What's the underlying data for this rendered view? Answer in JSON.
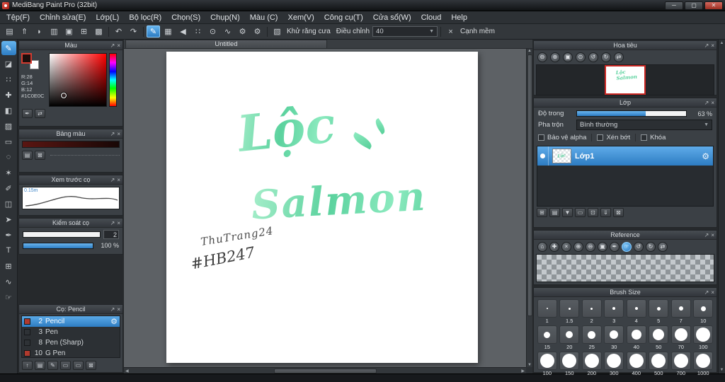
{
  "window": {
    "title": "MediBang Paint Pro (32bit)",
    "minimize": "─",
    "maximize": "▢",
    "close": "✕"
  },
  "menu": {
    "items": [
      "Tệp(F)",
      "Chỉnh sửa(E)",
      "Lớp(L)",
      "Bộ lọc(R)",
      "Chọn(S)",
      "Chụp(N)",
      "Màu (C)",
      "Xem(V)",
      "Công cụ(T)",
      "Cửa sổ(W)",
      "Cloud",
      "Help"
    ]
  },
  "toolbar": {
    "file_icons": [
      {
        "name": "new-canvas-icon",
        "glyph": "▤"
      },
      {
        "name": "save-icon",
        "glyph": "⇑"
      },
      {
        "name": "comment-icon",
        "glyph": "◗"
      },
      {
        "name": "copy-icon",
        "glyph": "▥"
      },
      {
        "name": "paste-icon",
        "glyph": "▣"
      },
      {
        "name": "grid-icon",
        "glyph": "⊞"
      },
      {
        "name": "material-panel-icon",
        "glyph": "▩"
      }
    ],
    "history_icons": [
      {
        "name": "undo-icon",
        "glyph": "↶"
      },
      {
        "name": "redo-icon",
        "glyph": "↷"
      }
    ],
    "brush_icons": [
      {
        "name": "current-tool-pen-icon",
        "glyph": "✎",
        "selected": true
      },
      {
        "name": "brush-type-icon",
        "glyph": "▦"
      },
      {
        "name": "brush-prev-icon",
        "glyph": "◀"
      },
      {
        "name": "brush-scatter-icon",
        "glyph": "∷"
      },
      {
        "name": "brush-pressure-icon",
        "glyph": "⊙"
      },
      {
        "name": "brush-curve-icon",
        "glyph": "∿"
      },
      {
        "name": "brush-settings-icon",
        "glyph": "⚙"
      },
      {
        "name": "brush-option-icon",
        "glyph": "⚙"
      }
    ],
    "antialias_icon": "▧",
    "antialias_label": "Khử răng cưa",
    "adjust_label": "Điều chỉnh",
    "adjust_value": "40",
    "soft_edge_icon": "×",
    "soft_edge_label": "Cạnh mềm"
  },
  "tools": {
    "items": [
      {
        "name": "brush-tool",
        "glyph": "✎",
        "selected": true
      },
      {
        "name": "eraser-tool",
        "glyph": "◪"
      },
      {
        "name": "dot-pen-tool",
        "glyph": "∷"
      },
      {
        "name": "move-tool",
        "glyph": "✚"
      },
      {
        "name": "bucket-tool",
        "glyph": "◧"
      },
      {
        "name": "gradient-tool",
        "glyph": "▨"
      },
      {
        "name": "select-tool",
        "glyph": "▭"
      },
      {
        "name": "lasso-tool",
        "glyph": "◌"
      },
      {
        "name": "magic-wand-tool",
        "glyph": "✶"
      },
      {
        "name": "select-pen-tool",
        "glyph": "✐"
      },
      {
        "name": "select-eraser-tool",
        "glyph": "◫"
      },
      {
        "name": "operation-tool",
        "glyph": "➤"
      },
      {
        "name": "eyedropper-tool",
        "glyph": "✒"
      },
      {
        "name": "text-tool",
        "glyph": "T"
      },
      {
        "name": "frame-tool",
        "glyph": "⊞"
      },
      {
        "name": "curve-tool",
        "glyph": "∿"
      },
      {
        "name": "hand-tool",
        "glyph": "☞"
      }
    ]
  },
  "color_panel": {
    "title": "Màu",
    "r": "R:28",
    "g": "G:14",
    "b": "B:12",
    "hex": "#1C0E0C",
    "fg_color": "#1C0E0C",
    "buttons": [
      {
        "name": "eyedropper-icon",
        "glyph": "✒"
      },
      {
        "name": "swap-colors-icon",
        "glyph": "⇄"
      }
    ]
  },
  "palette_panel": {
    "title": "Bảng màu",
    "buttons": [
      {
        "name": "add-color-icon",
        "glyph": "▤"
      },
      {
        "name": "delete-color-icon",
        "glyph": "⊠"
      }
    ]
  },
  "brush_preview_panel": {
    "title": "Xem trước cọ",
    "size_label": "0.15m"
  },
  "brush_control_panel": {
    "title": "Kiểm soát cọ",
    "size_value": "2",
    "opacity_value": "100 %",
    "opacity_fill_percent": 100
  },
  "brush_list_panel": {
    "title": "Cọ: Pencil",
    "brushes": [
      {
        "num": "2",
        "name": "Pencil",
        "swatch": "#b03a2e",
        "selected": true
      },
      {
        "num": "3",
        "name": "Pen",
        "swatch": "#2e3236",
        "selected": false
      },
      {
        "num": "8",
        "name": "Pen (Sharp)",
        "swatch": "#2e3236",
        "selected": false
      },
      {
        "num": "10",
        "name": "G Pen",
        "swatch": "#b03a2e",
        "selected": false
      }
    ],
    "buttons": [
      {
        "name": "add-brush-icon",
        "glyph": "↑"
      },
      {
        "name": "new-brush-icon",
        "glyph": "▤"
      },
      {
        "name": "brush-menu-icon",
        "glyph": "✎"
      },
      {
        "name": "brush-folder-icon",
        "glyph": "▭"
      },
      {
        "name": "brush-folder2-icon",
        "glyph": "▭"
      },
      {
        "name": "delete-brush-icon",
        "glyph": "⊠"
      }
    ]
  },
  "canvas": {
    "tab": "Untitled",
    "artwork": {
      "title_line1": "Lộc",
      "title_line2": "Salmon",
      "signature_line1": "ThuTrang24",
      "signature_line2": "#HB247",
      "ink_color": "#5bd29e"
    }
  },
  "navigator_panel": {
    "title": "Hoa tiêu",
    "icons": [
      {
        "name": "zoom-out-icon",
        "glyph": "⊖"
      },
      {
        "name": "zoom-in-icon",
        "glyph": "⊕"
      },
      {
        "name": "fit-window-icon",
        "glyph": "▣"
      },
      {
        "name": "actual-size-icon",
        "glyph": "⊙"
      },
      {
        "name": "rotate-ccw-icon",
        "glyph": "↺"
      },
      {
        "name": "rotate-cw-icon",
        "glyph": "↻"
      },
      {
        "name": "flip-horizontal-icon",
        "glyph": "⇄"
      }
    ]
  },
  "layer_panel": {
    "title": "Lớp",
    "opacity_label": "Độ trong",
    "opacity_value": "63 %",
    "opacity_percent": 63,
    "blend_label": "Pha trộn",
    "blend_value": "Bình thường",
    "alpha_label": "Bảo vệ alpha",
    "clip_label": "Xén bớt",
    "lock_label": "Khóa",
    "layers": [
      {
        "name": "Lớp1",
        "visible": true,
        "selected": true
      }
    ],
    "buttons": [
      {
        "name": "new-layer-icon",
        "glyph": "⊞"
      },
      {
        "name": "new-layer-alt-icon",
        "glyph": "▤"
      },
      {
        "name": "layer-menu-icon",
        "glyph": "▼"
      },
      {
        "name": "new-folder-icon",
        "glyph": "▭"
      },
      {
        "name": "duplicate-layer-icon",
        "glyph": "⊡"
      },
      {
        "name": "merge-down-icon",
        "glyph": "⇓"
      },
      {
        "name": "delete-layer-icon",
        "glyph": "⊠"
      }
    ]
  },
  "reference_panel": {
    "title": "Reference",
    "icons": [
      {
        "name": "ref-home-icon",
        "glyph": "⌂"
      },
      {
        "name": "ref-move-icon",
        "glyph": "✚"
      },
      {
        "name": "ref-close-icon",
        "glyph": "×"
      },
      {
        "name": "ref-zoom-in-icon",
        "glyph": "⊕"
      },
      {
        "name": "ref-zoom-out-icon",
        "glyph": "⊖"
      },
      {
        "name": "ref-fit-icon",
        "glyph": "▣"
      },
      {
        "name": "ref-eyedropper-icon",
        "glyph": "✒"
      },
      {
        "name": "ref-hand-icon",
        "glyph": "☞",
        "selected": true
      },
      {
        "name": "ref-rotate-ccw-icon",
        "glyph": "↺"
      },
      {
        "name": "ref-rotate-cw-icon",
        "glyph": "↻"
      },
      {
        "name": "ref-flip-icon",
        "glyph": "⇄"
      }
    ]
  },
  "brush_size_panel": {
    "title": "Brush Size",
    "sizes": [
      1,
      1.5,
      2,
      3,
      4,
      5,
      7,
      10,
      15,
      20,
      25,
      30,
      40,
      50,
      70,
      100,
      100,
      150,
      200,
      300,
      400,
      500,
      700,
      1000
    ]
  },
  "panel_chrome": {
    "popout": "↗",
    "close": "×"
  },
  "scrollbar": {
    "up": "▲",
    "down": "▼",
    "left": "◀",
    "right": "▶"
  }
}
